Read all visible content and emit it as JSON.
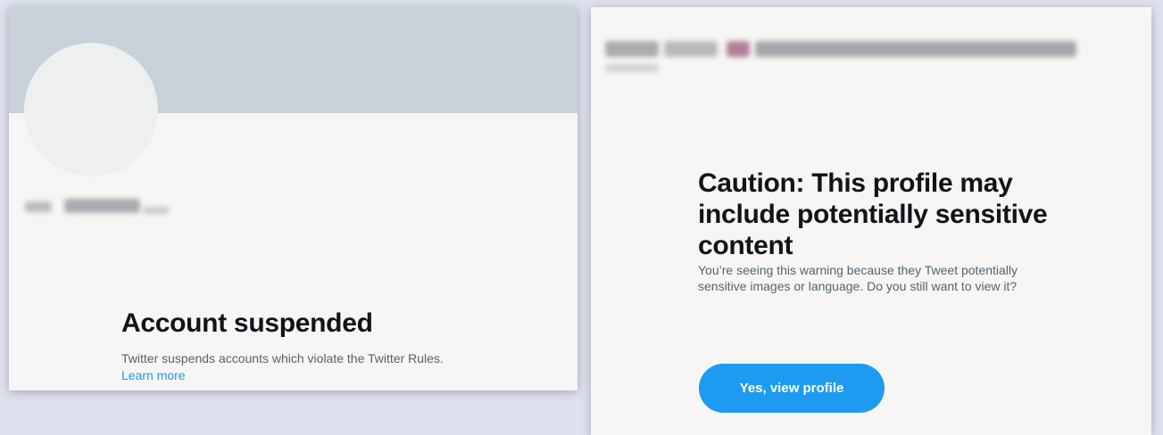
{
  "suspended_panel": {
    "title": "Account suspended",
    "body": "Twitter suspends accounts which violate the Twitter Rules.",
    "link_label": "Learn more"
  },
  "caution_panel": {
    "title": "Caution: This profile may include potentially sensitive content",
    "body": "You’re seeing this warning because they Tweet potentially sensitive images or language. Do you still want to view it?",
    "button_label": "Yes, view profile"
  },
  "colors": {
    "accent": "#1d9bf0",
    "title_text": "#0f1419",
    "secondary_text": "#536471",
    "banner": "#c8d2d8",
    "page_background": "#dfe1ee"
  }
}
